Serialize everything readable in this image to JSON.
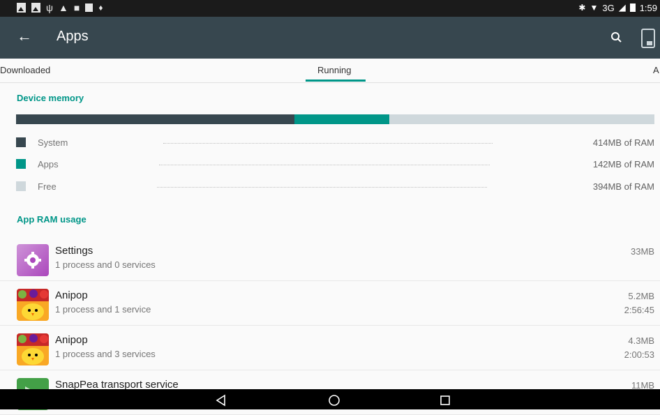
{
  "status_bar": {
    "time": "1:59",
    "network": "3G"
  },
  "app_bar": {
    "title": "Apps",
    "back_glyph": "←"
  },
  "tabs": [
    {
      "label": "Downloaded"
    },
    {
      "label": "Running"
    },
    {
      "label": "A"
    }
  ],
  "device_memory": {
    "header": "Device memory",
    "colors": {
      "system": "#37474f",
      "apps": "#009688",
      "free": "#cfd8dc"
    },
    "legend": [
      {
        "label": "System",
        "value": "414MB of RAM"
      },
      {
        "label": "Apps",
        "value": "142MB of RAM"
      },
      {
        "label": "Free",
        "value": "394MB of RAM"
      }
    ]
  },
  "app_ram": {
    "header": "App RAM usage",
    "rows": [
      {
        "name": "Settings",
        "detail": "1 process and 0 services",
        "memory": "33MB",
        "time": ""
      },
      {
        "name": "Anipop",
        "detail": "1 process and 1 service",
        "memory": "5.2MB",
        "time": "2:56:45"
      },
      {
        "name": "Anipop",
        "detail": "1 process and 3 services",
        "memory": "4.3MB",
        "time": "2:00:53"
      },
      {
        "name": "SnapPea transport service",
        "detail": "",
        "memory": "11MB",
        "time": ""
      }
    ]
  },
  "icons": {
    "back": "arrow-back-icon",
    "search": "search-icon",
    "device": "device-memory-icon",
    "settings": "settings-gear-icon",
    "anipop": "anipop-app-icon",
    "snappea": "snappea-app-icon"
  }
}
